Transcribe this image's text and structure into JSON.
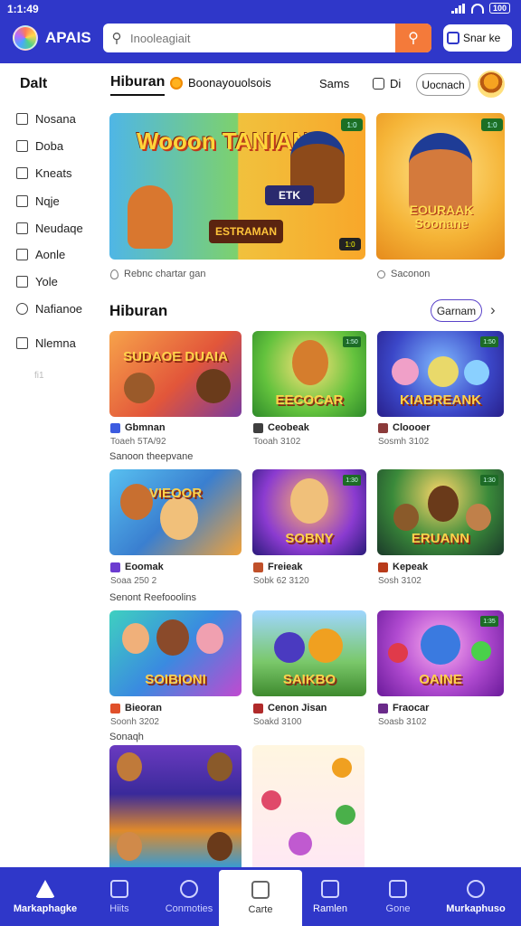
{
  "status": {
    "time": "1:1:49",
    "battery": "100"
  },
  "header": {
    "app_name": "APAIS",
    "search_placeholder": "Inooleagiait",
    "signin_label": "Snar ke"
  },
  "sidebar": {
    "title": "Dalt",
    "items": [
      {
        "label": "Nosana",
        "icon": "box-icon"
      },
      {
        "label": "Doba",
        "icon": "box-icon"
      },
      {
        "label": "Kneats",
        "icon": "box-icon"
      },
      {
        "label": "Nqje",
        "icon": "box-icon"
      },
      {
        "label": "Neudaqe",
        "icon": "box-icon"
      },
      {
        "label": "Aonle",
        "icon": "box-icon"
      },
      {
        "label": "Yole",
        "icon": "box-icon"
      },
      {
        "label": "Nafianoe",
        "icon": "chat-icon"
      },
      {
        "label": "Nlemna",
        "icon": "box-icon"
      }
    ],
    "faint": "fi1"
  },
  "tabs": {
    "active": "Hiburan",
    "sub": "Boonayouolsois",
    "games": "Sams",
    "cal": "Di",
    "pill": "Uocnach"
  },
  "featured": {
    "main_title": "Wooon TANIANS",
    "main_sign": "ESTRAMAN",
    "main_tag": "ETK",
    "main_badge": "1:0",
    "side_title": "EOURAAK Soonane",
    "side_badge": "1:0",
    "main_caption": "Rebnc chartar gan",
    "side_caption": "Saconon"
  },
  "section": {
    "title": "Hiburan",
    "pill": "Garnam"
  },
  "games": [
    {
      "art": "SUDAOE DUAIA",
      "name": "Gbmnan",
      "sub": "Toaeh 5TA/92",
      "badge": ""
    },
    {
      "art": "EECOCAR",
      "name": "Ceobeak",
      "sub": "Tooah 3102",
      "badge": "1:50"
    },
    {
      "art": "KIABREANK",
      "name": "Cloooer",
      "sub": "Sosmh 3102",
      "badge": "1:50"
    },
    {
      "art": "VIEOOR",
      "name": "Eoomak",
      "sub": "Soaa 250 2",
      "badge": ""
    },
    {
      "art": "SOBNY",
      "name": "Freieak",
      "sub": "Sobk 62 3120",
      "badge": "1:30"
    },
    {
      "art": "ERUANN",
      "name": "Kepeak",
      "sub": "Sosh 3102",
      "badge": "1:30"
    },
    {
      "art": "SOIBIONI",
      "name": "Bieoran",
      "sub": "Soonh 3202",
      "badge": ""
    },
    {
      "art": "SAIKBO",
      "name": "Cenon Jisan",
      "sub": "Soakd 3100",
      "badge": ""
    },
    {
      "art": "OAINE",
      "name": "Fraocar",
      "sub": "Soasb 3102",
      "badge": "1:35"
    }
  ],
  "row_labels": [
    "Sanoon theepvane",
    "Senont Reefooolins",
    "Sonaqh"
  ],
  "bottom_nav": [
    {
      "label": "Markaphagke",
      "icon": "home-icon"
    },
    {
      "label": "Hiits",
      "icon": "chart-icon"
    },
    {
      "label": "Conmoties",
      "icon": "circle-icon"
    },
    {
      "label": "Carte",
      "icon": "bag-icon"
    },
    {
      "label": "Ramlen",
      "icon": "store-icon"
    },
    {
      "label": "Gone",
      "icon": "game-icon"
    },
    {
      "label": "Murkaphuso",
      "icon": "user-icon"
    }
  ]
}
